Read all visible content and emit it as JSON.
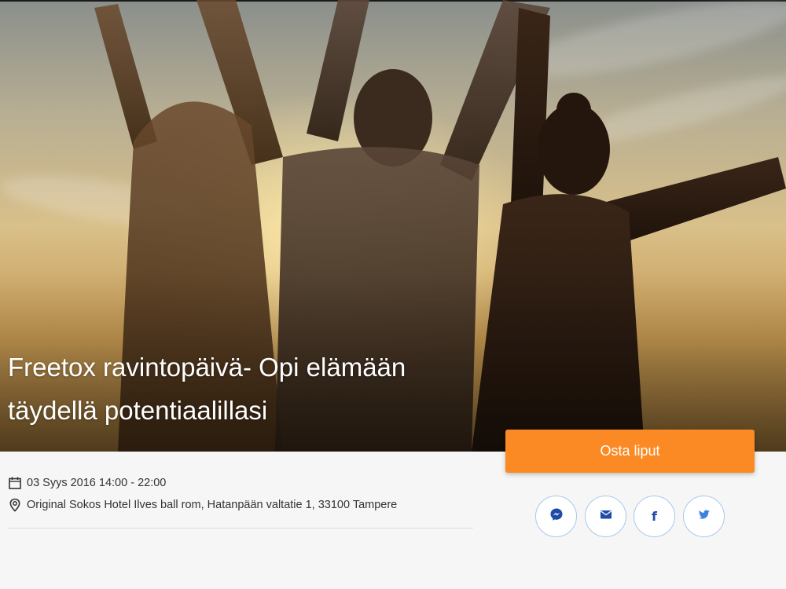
{
  "event": {
    "title_line1": "Freetox ravintopäivä- Opi elämään",
    "title_line2": "täydellä potentiaalillasi",
    "date": "03 Syys 2016 14:00 - 22:00",
    "location": "Original Sokos Hotel Ilves ball rom, Hatanpään valtatie 1, 33100 Tampere"
  },
  "actions": {
    "buy_label": "Osta liput"
  },
  "share": [
    {
      "icon": "messenger-icon"
    },
    {
      "icon": "email-icon"
    },
    {
      "icon": "facebook-icon",
      "glyph": "f"
    },
    {
      "icon": "twitter-icon"
    }
  ],
  "colors": {
    "accent": "#fb8a24",
    "share_icon": "#1f4aa8",
    "share_border": "#a9c8ef"
  }
}
